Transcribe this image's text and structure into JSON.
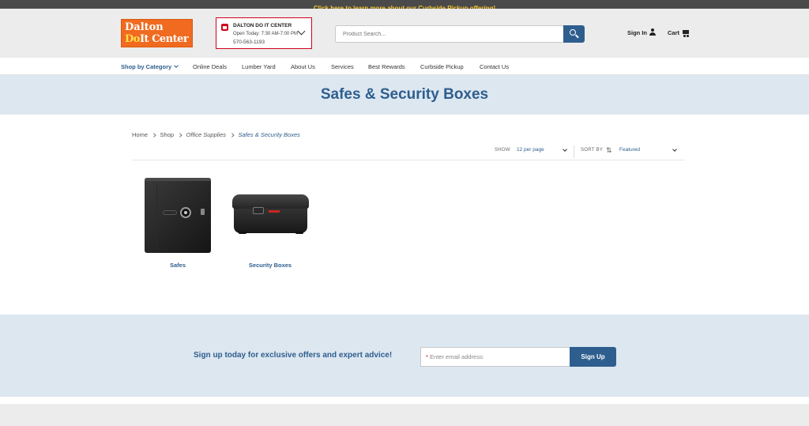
{
  "promo": {
    "text": "Click here to learn more about our Curbside Pickup offering!"
  },
  "header": {
    "logo_line1": "Dalton",
    "logo_line2_a": "Do",
    "logo_line2_b": "It Center",
    "store": {
      "name": "DALTON DO IT CENTER",
      "hours": "Open Today: 7:30 AM-7:00 PM",
      "phone": "570-563-1193"
    },
    "search": {
      "placeholder": "Product Search..."
    },
    "signin_label": "Sign In",
    "cart_label": "Cart"
  },
  "nav": {
    "items": [
      "Shop by Category",
      "Online Deals",
      "Lumber Yard",
      "About Us",
      "Services",
      "Best Rewards",
      "Curbside Pickup",
      "Contact Us"
    ]
  },
  "page": {
    "title": "Safes & Security Boxes"
  },
  "breadcrumb": [
    "Home",
    "Shop",
    "Office Supplies",
    "Safes & Security Boxes"
  ],
  "toolbar": {
    "show_label": "SHOW",
    "show_value": "12 per page",
    "sort_label": "SORT BY",
    "sort_value": "Featured"
  },
  "products": [
    {
      "label": "Safes"
    },
    {
      "label": "Security Boxes"
    }
  ],
  "newsletter": {
    "text": "Sign up today for exclusive offers and expert advice!",
    "placeholder_req": "*",
    "placeholder": "Enter email address:",
    "button": "Sign Up"
  },
  "colors": {
    "brand_blue": "#2e5e8e",
    "brand_orange": "#f06a1f",
    "promo_yellow": "#f4c430",
    "light_band": "#dde7f0",
    "store_red": "#d0021b"
  }
}
